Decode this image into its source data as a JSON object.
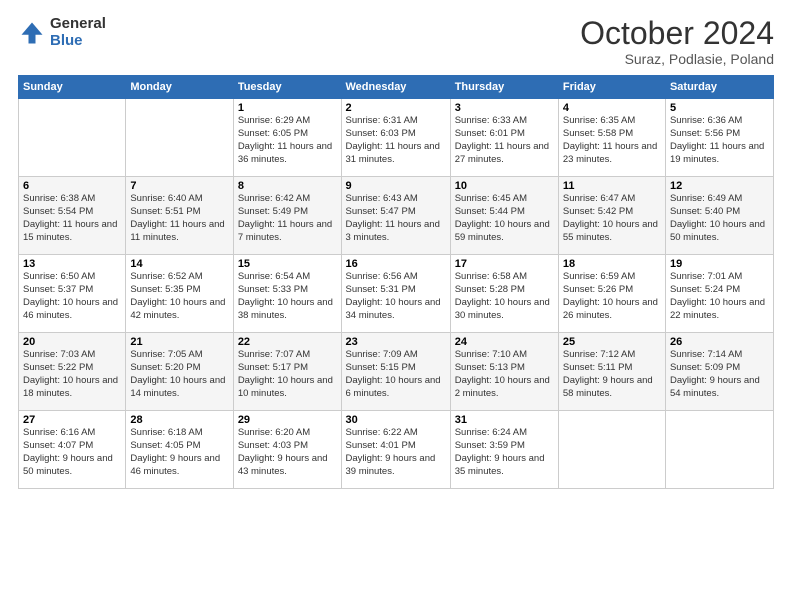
{
  "logo": {
    "general": "General",
    "blue": "Blue"
  },
  "title": {
    "month": "October 2024",
    "location": "Suraz, Podlasie, Poland"
  },
  "weekdays": [
    "Sunday",
    "Monday",
    "Tuesday",
    "Wednesday",
    "Thursday",
    "Friday",
    "Saturday"
  ],
  "weeks": [
    [
      {
        "day": "",
        "sunrise": "",
        "sunset": "",
        "daylight": ""
      },
      {
        "day": "",
        "sunrise": "",
        "sunset": "",
        "daylight": ""
      },
      {
        "day": "1",
        "sunrise": "Sunrise: 6:29 AM",
        "sunset": "Sunset: 6:05 PM",
        "daylight": "Daylight: 11 hours and 36 minutes."
      },
      {
        "day": "2",
        "sunrise": "Sunrise: 6:31 AM",
        "sunset": "Sunset: 6:03 PM",
        "daylight": "Daylight: 11 hours and 31 minutes."
      },
      {
        "day": "3",
        "sunrise": "Sunrise: 6:33 AM",
        "sunset": "Sunset: 6:01 PM",
        "daylight": "Daylight: 11 hours and 27 minutes."
      },
      {
        "day": "4",
        "sunrise": "Sunrise: 6:35 AM",
        "sunset": "Sunset: 5:58 PM",
        "daylight": "Daylight: 11 hours and 23 minutes."
      },
      {
        "day": "5",
        "sunrise": "Sunrise: 6:36 AM",
        "sunset": "Sunset: 5:56 PM",
        "daylight": "Daylight: 11 hours and 19 minutes."
      }
    ],
    [
      {
        "day": "6",
        "sunrise": "Sunrise: 6:38 AM",
        "sunset": "Sunset: 5:54 PM",
        "daylight": "Daylight: 11 hours and 15 minutes."
      },
      {
        "day": "7",
        "sunrise": "Sunrise: 6:40 AM",
        "sunset": "Sunset: 5:51 PM",
        "daylight": "Daylight: 11 hours and 11 minutes."
      },
      {
        "day": "8",
        "sunrise": "Sunrise: 6:42 AM",
        "sunset": "Sunset: 5:49 PM",
        "daylight": "Daylight: 11 hours and 7 minutes."
      },
      {
        "day": "9",
        "sunrise": "Sunrise: 6:43 AM",
        "sunset": "Sunset: 5:47 PM",
        "daylight": "Daylight: 11 hours and 3 minutes."
      },
      {
        "day": "10",
        "sunrise": "Sunrise: 6:45 AM",
        "sunset": "Sunset: 5:44 PM",
        "daylight": "Daylight: 10 hours and 59 minutes."
      },
      {
        "day": "11",
        "sunrise": "Sunrise: 6:47 AM",
        "sunset": "Sunset: 5:42 PM",
        "daylight": "Daylight: 10 hours and 55 minutes."
      },
      {
        "day": "12",
        "sunrise": "Sunrise: 6:49 AM",
        "sunset": "Sunset: 5:40 PM",
        "daylight": "Daylight: 10 hours and 50 minutes."
      }
    ],
    [
      {
        "day": "13",
        "sunrise": "Sunrise: 6:50 AM",
        "sunset": "Sunset: 5:37 PM",
        "daylight": "Daylight: 10 hours and 46 minutes."
      },
      {
        "day": "14",
        "sunrise": "Sunrise: 6:52 AM",
        "sunset": "Sunset: 5:35 PM",
        "daylight": "Daylight: 10 hours and 42 minutes."
      },
      {
        "day": "15",
        "sunrise": "Sunrise: 6:54 AM",
        "sunset": "Sunset: 5:33 PM",
        "daylight": "Daylight: 10 hours and 38 minutes."
      },
      {
        "day": "16",
        "sunrise": "Sunrise: 6:56 AM",
        "sunset": "Sunset: 5:31 PM",
        "daylight": "Daylight: 10 hours and 34 minutes."
      },
      {
        "day": "17",
        "sunrise": "Sunrise: 6:58 AM",
        "sunset": "Sunset: 5:28 PM",
        "daylight": "Daylight: 10 hours and 30 minutes."
      },
      {
        "day": "18",
        "sunrise": "Sunrise: 6:59 AM",
        "sunset": "Sunset: 5:26 PM",
        "daylight": "Daylight: 10 hours and 26 minutes."
      },
      {
        "day": "19",
        "sunrise": "Sunrise: 7:01 AM",
        "sunset": "Sunset: 5:24 PM",
        "daylight": "Daylight: 10 hours and 22 minutes."
      }
    ],
    [
      {
        "day": "20",
        "sunrise": "Sunrise: 7:03 AM",
        "sunset": "Sunset: 5:22 PM",
        "daylight": "Daylight: 10 hours and 18 minutes."
      },
      {
        "day": "21",
        "sunrise": "Sunrise: 7:05 AM",
        "sunset": "Sunset: 5:20 PM",
        "daylight": "Daylight: 10 hours and 14 minutes."
      },
      {
        "day": "22",
        "sunrise": "Sunrise: 7:07 AM",
        "sunset": "Sunset: 5:17 PM",
        "daylight": "Daylight: 10 hours and 10 minutes."
      },
      {
        "day": "23",
        "sunrise": "Sunrise: 7:09 AM",
        "sunset": "Sunset: 5:15 PM",
        "daylight": "Daylight: 10 hours and 6 minutes."
      },
      {
        "day": "24",
        "sunrise": "Sunrise: 7:10 AM",
        "sunset": "Sunset: 5:13 PM",
        "daylight": "Daylight: 10 hours and 2 minutes."
      },
      {
        "day": "25",
        "sunrise": "Sunrise: 7:12 AM",
        "sunset": "Sunset: 5:11 PM",
        "daylight": "Daylight: 9 hours and 58 minutes."
      },
      {
        "day": "26",
        "sunrise": "Sunrise: 7:14 AM",
        "sunset": "Sunset: 5:09 PM",
        "daylight": "Daylight: 9 hours and 54 minutes."
      }
    ],
    [
      {
        "day": "27",
        "sunrise": "Sunrise: 6:16 AM",
        "sunset": "Sunset: 4:07 PM",
        "daylight": "Daylight: 9 hours and 50 minutes."
      },
      {
        "day": "28",
        "sunrise": "Sunrise: 6:18 AM",
        "sunset": "Sunset: 4:05 PM",
        "daylight": "Daylight: 9 hours and 46 minutes."
      },
      {
        "day": "29",
        "sunrise": "Sunrise: 6:20 AM",
        "sunset": "Sunset: 4:03 PM",
        "daylight": "Daylight: 9 hours and 43 minutes."
      },
      {
        "day": "30",
        "sunrise": "Sunrise: 6:22 AM",
        "sunset": "Sunset: 4:01 PM",
        "daylight": "Daylight: 9 hours and 39 minutes."
      },
      {
        "day": "31",
        "sunrise": "Sunrise: 6:24 AM",
        "sunset": "Sunset: 3:59 PM",
        "daylight": "Daylight: 9 hours and 35 minutes."
      },
      {
        "day": "",
        "sunrise": "",
        "sunset": "",
        "daylight": ""
      },
      {
        "day": "",
        "sunrise": "",
        "sunset": "",
        "daylight": ""
      }
    ]
  ]
}
